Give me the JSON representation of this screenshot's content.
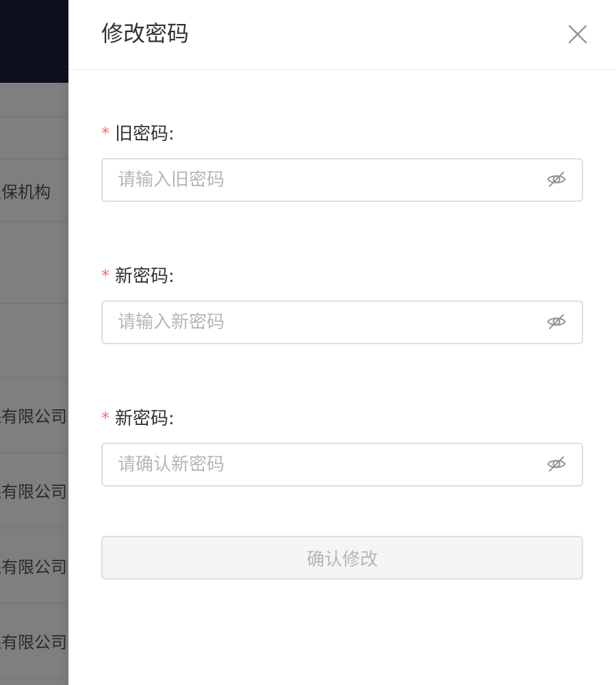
{
  "background": {
    "rows": [
      {
        "text": "担保机构"
      },
      {
        "text": "保有限公司"
      },
      {
        "text": "保有限公司"
      },
      {
        "text": "保有限公司"
      },
      {
        "text": "保有限公司"
      }
    ]
  },
  "drawer": {
    "title": "修改密码",
    "close_icon": "close-icon",
    "required_mark": "*",
    "fields": [
      {
        "label": "旧密码:",
        "placeholder": "请输入旧密码",
        "value": "",
        "icon": "eye-off-icon"
      },
      {
        "label": "新密码:",
        "placeholder": "请输入新密码",
        "value": "",
        "icon": "eye-off-icon"
      },
      {
        "label": "新密码:",
        "placeholder": "请确认新密码",
        "value": "",
        "icon": "eye-off-icon"
      }
    ],
    "submit_label": "确认修改"
  },
  "colors": {
    "header_bg": "#1c2140",
    "required": "#f56c6c",
    "placeholder": "#b3b6bc",
    "border": "#dcdfe6"
  }
}
